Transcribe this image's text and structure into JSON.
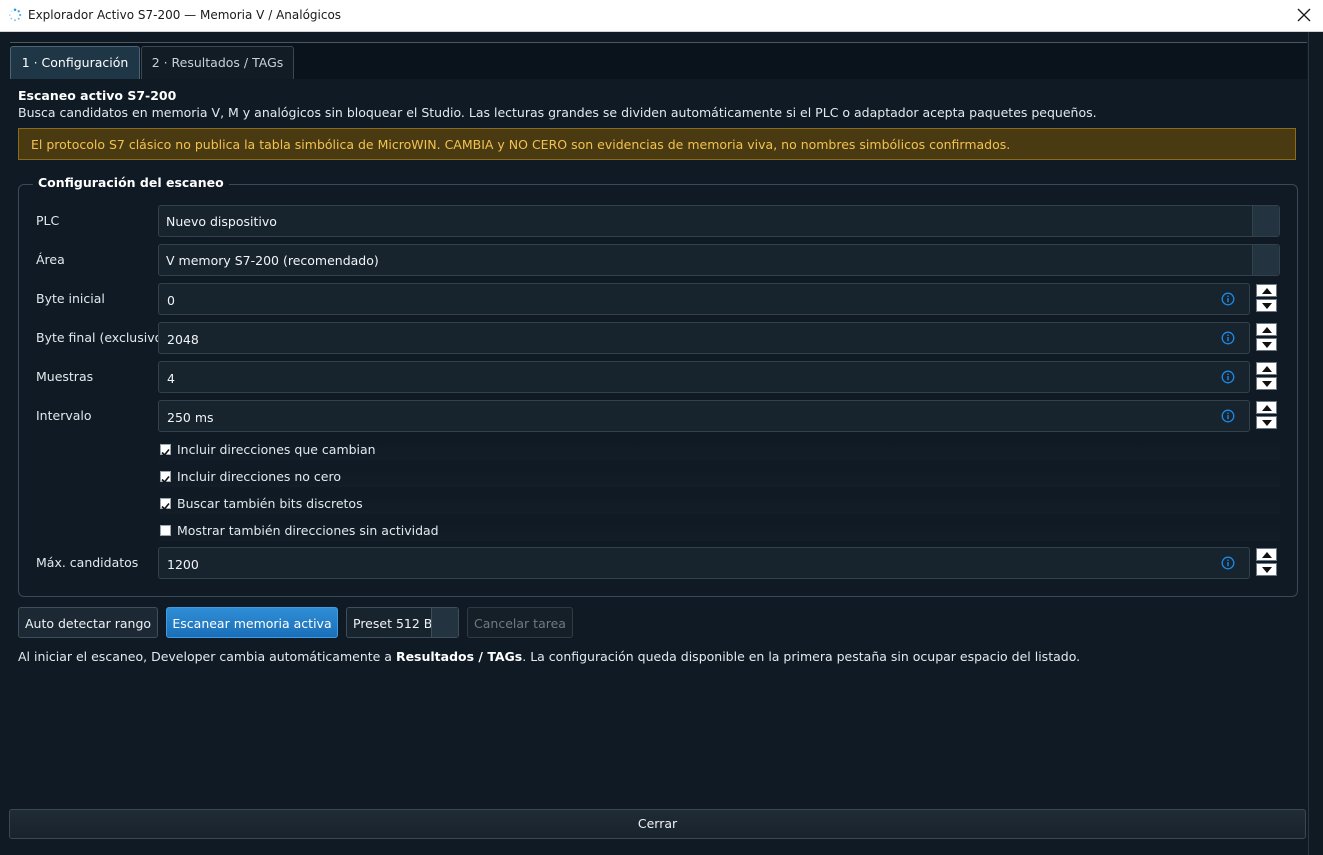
{
  "window": {
    "title": "Explorador Activo S7-200 — Memoria V / Analógicos",
    "icon": "loading-spinner-icon",
    "close_icon": "close-icon"
  },
  "tabs": [
    {
      "label": "1 · Configuración",
      "active": true
    },
    {
      "label": "2 · Resultados / TAGs",
      "active": false
    }
  ],
  "intro": {
    "heading": "Escaneo activo S7-200",
    "description": "Busca candidatos en memoria V, M y analógicos sin bloquear el Studio. Las lecturas grandes se dividen automáticamente si el PLC o adaptador acepta paquetes pequeños."
  },
  "warning": {
    "text": "El protocolo S7 clásico no publica la tabla simbólica de MicroWIN. CAMBIA y NO CERO son evidencias de memoria viva, no nombres simbólicos confirmados."
  },
  "config": {
    "group_title": "Configuración del escaneo",
    "plc": {
      "label": "PLC",
      "value": "Nuevo dispositivo"
    },
    "area": {
      "label": "Área",
      "value": "V memory S7-200 (recomendado)"
    },
    "byte_start": {
      "label": "Byte inicial",
      "value": "0"
    },
    "byte_end": {
      "label": "Byte final (exclusivo)",
      "value": "2048"
    },
    "samples": {
      "label": "Muestras",
      "value": "4"
    },
    "interval": {
      "label": "Intervalo",
      "value": "250 ms"
    },
    "checks": [
      {
        "label": "Incluir direcciones que cambian",
        "checked": true
      },
      {
        "label": "Incluir direcciones no cero",
        "checked": true
      },
      {
        "label": "Buscar también bits discretos",
        "checked": true
      },
      {
        "label": "Mostrar también direcciones sin actividad",
        "checked": false
      }
    ],
    "max_candidates": {
      "label": "Máx. candidatos",
      "value": "1200"
    }
  },
  "actions": {
    "auto_detect": "Auto detectar rango",
    "scan": "Escanear memoria activa",
    "preset": "Preset 512 B",
    "cancel": "Cancelar tarea"
  },
  "footnote": {
    "before": "Al iniciar el escaneo, Developer cambia automáticamente a ",
    "bold": "Resultados / TAGs",
    "after": ". La configuración queda disponible en la primera pestaña sin ocupar espacio del listado."
  },
  "close_button": "Cerrar",
  "colors": {
    "accent": "#1f7fcc",
    "warning_bg": "#4a3a12",
    "warning_text": "#f2c24f",
    "info_icon": "#1e88e5"
  }
}
